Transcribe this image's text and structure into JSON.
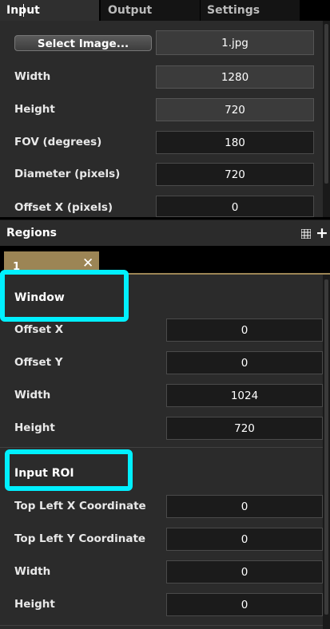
{
  "tabs": [
    {
      "label": "Input"
    },
    {
      "label": "Output"
    },
    {
      "label": "Settings"
    }
  ],
  "input": {
    "select_image_label": "Select Image...",
    "image_file": "1.jpg",
    "rows": [
      {
        "label": "Width",
        "value": "1280"
      },
      {
        "label": "Height",
        "value": "720"
      },
      {
        "label": "FOV (degrees)",
        "value": "180"
      },
      {
        "label": "Diameter (pixels)",
        "value": "720"
      },
      {
        "label": "Offset X (pixels)",
        "value": "0"
      }
    ]
  },
  "regions": {
    "title": "Regions",
    "tab_label": "1",
    "window": {
      "title": "Window",
      "rows": [
        {
          "label": "Offset X",
          "value": "0"
        },
        {
          "label": "Offset Y",
          "value": "0"
        },
        {
          "label": "Width",
          "value": "1024"
        },
        {
          "label": "Height",
          "value": "720"
        }
      ]
    },
    "input_roi": {
      "title": "Input ROI",
      "rows": [
        {
          "label": "Top Left X Coordinate",
          "value": "0"
        },
        {
          "label": "Top Left Y Coordinate",
          "value": "0"
        },
        {
          "label": "Width",
          "value": "0"
        },
        {
          "label": "Height",
          "value": "0"
        }
      ]
    }
  },
  "icons": {
    "grid": "grid-icon",
    "add": "plus-icon",
    "close": "close-icon"
  },
  "colors": {
    "accent": "#9c8555",
    "highlight": "#00f0ff",
    "panel": "#2b2b2b"
  }
}
